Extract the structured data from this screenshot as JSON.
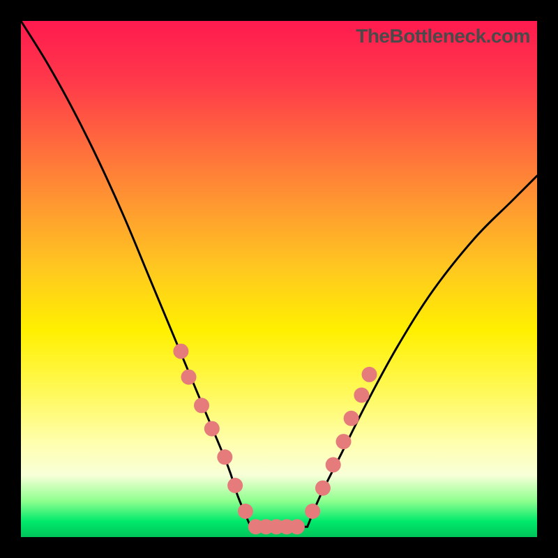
{
  "watermark": "TheBottleneck.com",
  "chart_data": {
    "type": "line",
    "title": "",
    "xlabel": "",
    "ylabel": "",
    "xlim": [
      0,
      100
    ],
    "ylim": [
      0,
      100
    ],
    "grid": false,
    "series": [
      {
        "name": "left-curve",
        "x": [
          0,
          5,
          10,
          15,
          20,
          25,
          30,
          35,
          40,
          42,
          44.5
        ],
        "y": [
          100,
          92,
          83,
          73,
          62,
          50,
          38,
          26,
          14,
          8,
          2
        ]
      },
      {
        "name": "right-curve",
        "x": [
          55.5,
          58,
          62,
          67,
          73,
          80,
          88,
          95,
          100
        ],
        "y": [
          2,
          8,
          16,
          26,
          37,
          48,
          58,
          65,
          70
        ]
      },
      {
        "name": "floor",
        "x": [
          44.5,
          55.5
        ],
        "y": [
          2,
          2
        ]
      }
    ],
    "markers": {
      "left": [
        {
          "x": 31,
          "y": 36
        },
        {
          "x": 32.5,
          "y": 31
        },
        {
          "x": 35,
          "y": 25.5
        },
        {
          "x": 37,
          "y": 21
        },
        {
          "x": 39.5,
          "y": 15.5
        },
        {
          "x": 41.5,
          "y": 10
        },
        {
          "x": 43.5,
          "y": 5
        }
      ],
      "right": [
        {
          "x": 56.5,
          "y": 5
        },
        {
          "x": 58.5,
          "y": 9.5
        },
        {
          "x": 60.5,
          "y": 14
        },
        {
          "x": 62.5,
          "y": 18.5
        },
        {
          "x": 64,
          "y": 23
        },
        {
          "x": 66,
          "y": 27.5
        },
        {
          "x": 67.5,
          "y": 31.5
        }
      ],
      "floor": [
        {
          "x": 45.5,
          "y": 2
        },
        {
          "x": 47.5,
          "y": 2
        },
        {
          "x": 49.5,
          "y": 2
        },
        {
          "x": 51.5,
          "y": 2
        },
        {
          "x": 53.5,
          "y": 2
        }
      ]
    },
    "colors": {
      "curve": "#000000",
      "marker": "#e57b7b"
    }
  }
}
